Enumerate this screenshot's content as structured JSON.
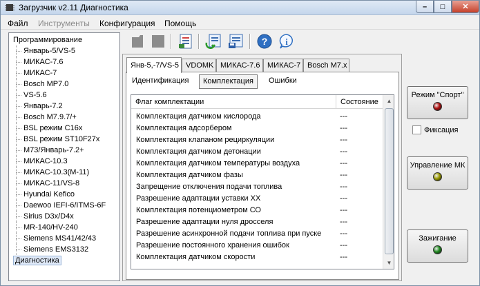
{
  "window": {
    "title": "Загрузчик v2.11 Диагностика",
    "controls": {
      "minimize": "–",
      "maximize": "□",
      "close": "✕"
    }
  },
  "menu": [
    {
      "label": "Файл",
      "enabled": true
    },
    {
      "label": "Инструменты",
      "enabled": false
    },
    {
      "label": "Конфигурация",
      "enabled": true
    },
    {
      "label": "Помощь",
      "enabled": true
    }
  ],
  "tree": {
    "items": [
      {
        "label": "Программирование",
        "level": 0
      },
      {
        "label": "Январь-5/VS-5",
        "level": 1
      },
      {
        "label": "МИКАС-7.6",
        "level": 1
      },
      {
        "label": "МИКАС-7",
        "level": 1
      },
      {
        "label": "Bosch MP7.0",
        "level": 1
      },
      {
        "label": "VS-5.6",
        "level": 1
      },
      {
        "label": "Январь-7.2",
        "level": 1
      },
      {
        "label": "Bosch M7.9.7/+",
        "level": 1
      },
      {
        "label": "BSL режим C16x",
        "level": 1
      },
      {
        "label": "BSL режим ST10F27x",
        "level": 1
      },
      {
        "label": "M73/Январь-7.2+",
        "level": 1
      },
      {
        "label": "МИКАС-10.3",
        "level": 1
      },
      {
        "label": "МИКАС-10.3(М-11)",
        "level": 1
      },
      {
        "label": "МИКАС-11/VS-8",
        "level": 1
      },
      {
        "label": "Hyundai Kefico",
        "level": 1
      },
      {
        "label": "Daewoo IEFI-6/ITMS-6F",
        "level": 1
      },
      {
        "label": "Sirius D3x/D4x",
        "level": 1
      },
      {
        "label": "MR-140/HV-240",
        "level": 1
      },
      {
        "label": "Siemens MS41/42/43",
        "level": 1
      },
      {
        "label": "Siemens EMS3132",
        "level": 1
      },
      {
        "label": "Диагностика",
        "level": 0,
        "selected": true
      }
    ]
  },
  "toolbar": {
    "icons": [
      "disabled-read-icon",
      "disabled-stop-icon",
      "report-icon",
      "refresh-download-icon",
      "save-data-icon",
      "help-icon",
      "info-icon"
    ]
  },
  "ecu_tabs": [
    {
      "label": "Янв-5,-7/VS-5",
      "active": true
    },
    {
      "label": "VDOMK",
      "active": false
    },
    {
      "label": "МИКАС-7.6",
      "active": false
    },
    {
      "label": "МИКАС-7",
      "active": false
    },
    {
      "label": "Bosch M7.x",
      "active": false
    }
  ],
  "sub_tabs": [
    {
      "label": "Идентификация",
      "active": false
    },
    {
      "label": "Комплектация",
      "active": true
    },
    {
      "label": "Ошибки",
      "active": false
    }
  ],
  "table": {
    "columns": [
      "Флаг комплектации",
      "Состояние"
    ],
    "rows": [
      {
        "flag": "Комплектация датчиком кислорода",
        "state": "---"
      },
      {
        "flag": "Комплектация адсорбером",
        "state": "---"
      },
      {
        "flag": "Комплектация клапаном рециркуляции",
        "state": "---"
      },
      {
        "flag": "Комплектация датчиком детонации",
        "state": "---"
      },
      {
        "flag": "Комплектация датчиком температуры воздуха",
        "state": "---"
      },
      {
        "flag": "Комплектация датчиком фазы",
        "state": "---"
      },
      {
        "flag": "Запрещение отключения подачи топлива",
        "state": "---"
      },
      {
        "flag": "Разрешение адаптации уставки ХХ",
        "state": "---"
      },
      {
        "flag": "Комплектация потенциометром СО",
        "state": "---"
      },
      {
        "flag": "Разрешение адаптации нуля дросселя",
        "state": "---"
      },
      {
        "flag": "Разрешение асинхронной подачи топлива при пуске",
        "state": "---"
      },
      {
        "flag": "Разрешение постоянного хранения ошибок",
        "state": "---"
      },
      {
        "flag": "Комплектация датчиком скорости",
        "state": "---"
      }
    ]
  },
  "side_controls": {
    "sport_button": {
      "label": "Режим \"Спорт\"",
      "lamp_color": "#b01010"
    },
    "fixation": {
      "label": "Фиксация",
      "checked": false
    },
    "mk_button": {
      "label": "Управление МК",
      "lamp_color": "#9a9a00"
    },
    "ignition_button": {
      "label": "Зажигание",
      "lamp_color": "#1f8a1f"
    }
  }
}
